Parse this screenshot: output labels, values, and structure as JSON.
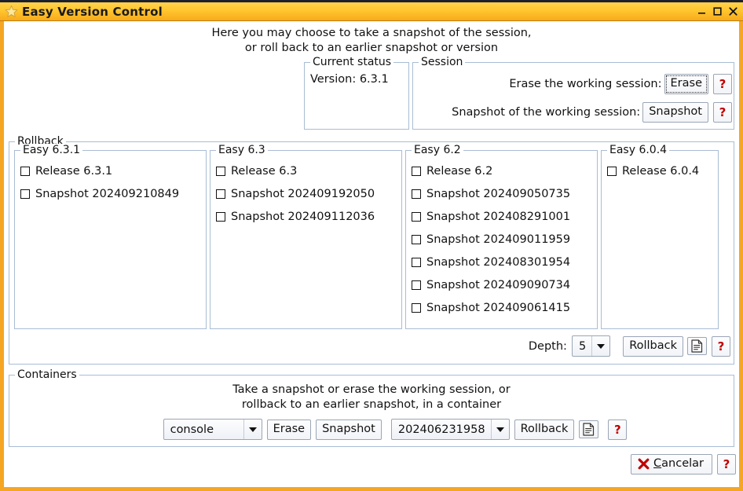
{
  "window": {
    "title": "Easy Version Control",
    "star_icon": "star-icon",
    "minimize_label": "minimize-icon",
    "maximize_label": "maximize-icon",
    "close_label": "close-icon",
    "frame_color": "#f5a623",
    "titlebar_color": "#ffc62e"
  },
  "intro": {
    "line1": "Here you may choose to take a snapshot of the session,",
    "line2": "or roll back to an earlier snapshot or version"
  },
  "status": {
    "legend": "Current status",
    "version": "Version: 6.3.1"
  },
  "session": {
    "legend": "Session",
    "erase_label": "Erase the working session:",
    "erase_button": "Erase",
    "snapshot_label": "Snapshot of the working session:",
    "snapshot_button": "Snapshot",
    "help": "?"
  },
  "rollback": {
    "legend": "Rollback",
    "columns": [
      {
        "legend": "Easy 6.3.1",
        "items": [
          "Release 6.3.1",
          "Snapshot 202409210849"
        ]
      },
      {
        "legend": "Easy 6.3",
        "items": [
          "Release 6.3",
          "Snapshot 202409192050",
          "Snapshot 202409112036"
        ]
      },
      {
        "legend": "Easy 6.2",
        "items": [
          "Release 6.2",
          "Snapshot 202409050735",
          "Snapshot 202408291001",
          "Snapshot 202409011959",
          "Snapshot 202408301954",
          "Snapshot 202409090734",
          "Snapshot 202409061415"
        ]
      },
      {
        "legend": "Easy 6.0.4",
        "items": [
          "Release 6.0.4"
        ]
      }
    ],
    "depth_label": "Depth:",
    "depth_value": "5",
    "rollback_button": "Rollback",
    "log_icon": "document-icon",
    "help": "?"
  },
  "containers": {
    "legend": "Containers",
    "text_line1": "Take a snapshot or erase the working session, or",
    "text_line2": "rollback to an earlier snapshot, in a container",
    "container_value": "console",
    "erase_button": "Erase",
    "snapshot_button": "Snapshot",
    "snapshot_value": "202406231958",
    "rollback_button": "Rollback",
    "log_icon": "document-icon",
    "help": "?"
  },
  "footer": {
    "cancel_mnemonic": "C",
    "cancel_rest": "ancelar",
    "cancel_icon": "red-x-icon",
    "help": "?"
  }
}
